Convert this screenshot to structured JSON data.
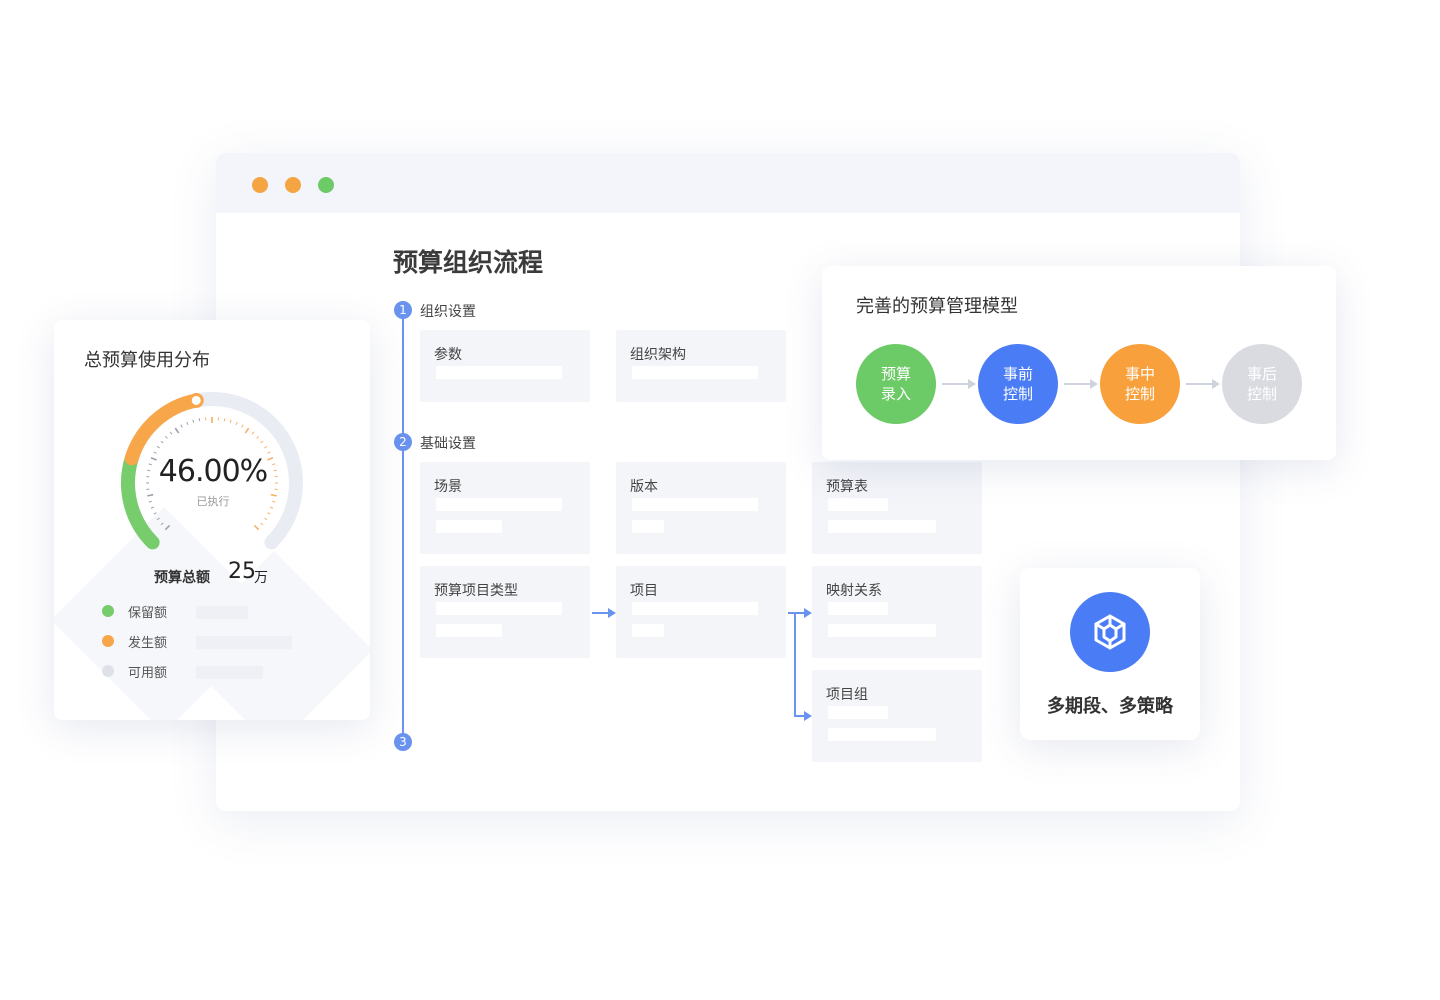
{
  "window": {
    "title": "预算组织流程",
    "dots": [
      "#f5a442",
      "#f5a442",
      "#6ccb66"
    ]
  },
  "flow": {
    "steps": [
      {
        "num": "1",
        "label": "组织设置"
      },
      {
        "num": "2",
        "label": "基础设置"
      },
      {
        "num": "3",
        "label": ""
      }
    ],
    "cards": {
      "params": "参数",
      "org_structure": "组织架构",
      "scene": "场景",
      "version": "版本",
      "budget_table": "预算表",
      "item_type": "预算项目类型",
      "item": "项目",
      "mapping": "映射关系",
      "item_group": "项目组"
    }
  },
  "budget_usage": {
    "title": "总预算使用分布",
    "percent": 46.0,
    "percent_text": "46.00%",
    "executed_label": "已执行",
    "total_label": "预算总额",
    "total_value": "25",
    "total_unit": "万",
    "legend": [
      {
        "label": "保留额",
        "color": "#77cc6c",
        "value": 0.41
      },
      {
        "label": "发生额",
        "color": "#f7a64a",
        "value": 0.76
      },
      {
        "label": "可用额",
        "color": "#dfe1e8",
        "value": 0.53
      }
    ],
    "colors": {
      "green": "#77cc6c",
      "orange": "#f7a64a",
      "track": "#e9ecf2"
    }
  },
  "model": {
    "title": "完善的预算管理模型",
    "stages": [
      {
        "label": "预算录入",
        "color": "#6ccb66"
      },
      {
        "label": "事前控制",
        "color": "#4a7cf5"
      },
      {
        "label": "事中控制",
        "color": "#f7a03c"
      },
      {
        "label": "事后控制",
        "color": "#d9dbe1"
      }
    ]
  },
  "strategy": {
    "label": "多期段、多策略",
    "icon": "cube-icon",
    "color": "#4a7cf5"
  },
  "accent": "#6a93f0"
}
